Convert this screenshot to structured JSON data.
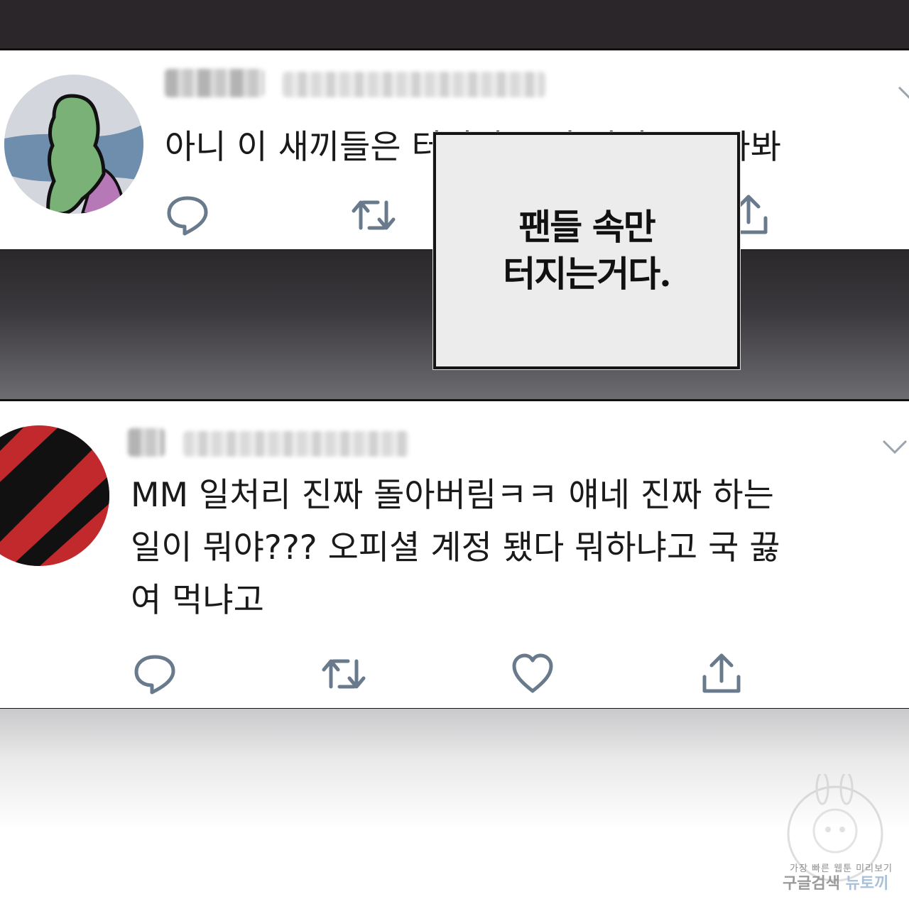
{
  "tweets": [
    {
      "text": "아니 이 새끼들은 터지의 뜻이 뭔지 모르나봐",
      "avatar_colors": {
        "bg": "#d4d6de",
        "sky": "#6f8ead",
        "body": "#79b176",
        "arm": "#b678b6",
        "outline": "#111111"
      },
      "actions": [
        "reply-icon",
        "retweet-icon",
        "like-icon",
        "share-icon"
      ]
    },
    {
      "text": "MM 일처리 진짜 돌아버림ㅋㅋ 얘네 진짜 하는\n일이 뭐야??? 오피셜 계정 됐다 뭐하냐고 국 끓\n여 먹냐고",
      "avatar_colors": {
        "red": "#c1292c",
        "black": "#111111"
      },
      "actions": [
        "reply-icon",
        "retweet-icon",
        "like-icon",
        "share-icon"
      ]
    }
  ],
  "caption": {
    "line1": "팬들 속만",
    "line2": "터지는거다."
  },
  "watermark": {
    "line1": "가장 빠른 웹툰 미리보기",
    "line2_a": "구글검색",
    "line2_b": "뉴토끼"
  },
  "colors": {
    "icon": "#687a8b",
    "band": "#2a2629",
    "text": "#1a1a1a"
  }
}
